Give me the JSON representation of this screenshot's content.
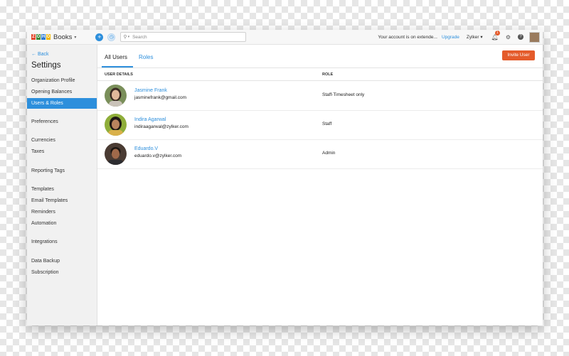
{
  "topbar": {
    "logo_letters": [
      "Z",
      "O",
      "H",
      "O"
    ],
    "logo_colors": [
      "#e2482d",
      "#3b8c3a",
      "#2d7ad1",
      "#f2b807"
    ],
    "app_name": "Books",
    "search_placeholder": "Search",
    "account_message": "Your account is on extende...",
    "upgrade_label": "Upgrade",
    "org_name": "Zylker",
    "notification_count": "1",
    "plus_icon": "plus-icon",
    "history_icon": "history-icon"
  },
  "sidebar": {
    "back_label": "Back",
    "title": "Settings",
    "items": [
      {
        "label": "Organization Profile"
      },
      {
        "label": "Opening Balances"
      },
      {
        "label": "Users & Roles",
        "active": true
      },
      {
        "label": "Preferences"
      },
      {
        "label": "Currencies"
      },
      {
        "label": "Taxes"
      },
      {
        "label": "Reporting Tags"
      },
      {
        "label": "Templates"
      },
      {
        "label": "Email Templates"
      },
      {
        "label": "Reminders"
      },
      {
        "label": "Automation"
      },
      {
        "label": "Integrations"
      },
      {
        "label": "Data Backup"
      },
      {
        "label": "Subscription"
      }
    ]
  },
  "main": {
    "tabs": [
      {
        "label": "All Users",
        "active": true
      },
      {
        "label": "Roles"
      }
    ],
    "invite_button": "Invite User",
    "columns": [
      "USER DETAILS",
      "ROLE"
    ],
    "users": [
      {
        "name": "Jasmine Frank",
        "email": "jasminefrank@gmail.com",
        "role": "Staff-Timesheet only"
      },
      {
        "name": "Indira Agarwal",
        "email": "indiraagarwal@zylker.com",
        "role": "Staff"
      },
      {
        "name": "Eduardo.V",
        "email": "eduardo.v@zylker.com",
        "role": "Admin"
      }
    ]
  },
  "colors": {
    "accent": "#2d8fdc",
    "invite": "#e45b2b"
  }
}
